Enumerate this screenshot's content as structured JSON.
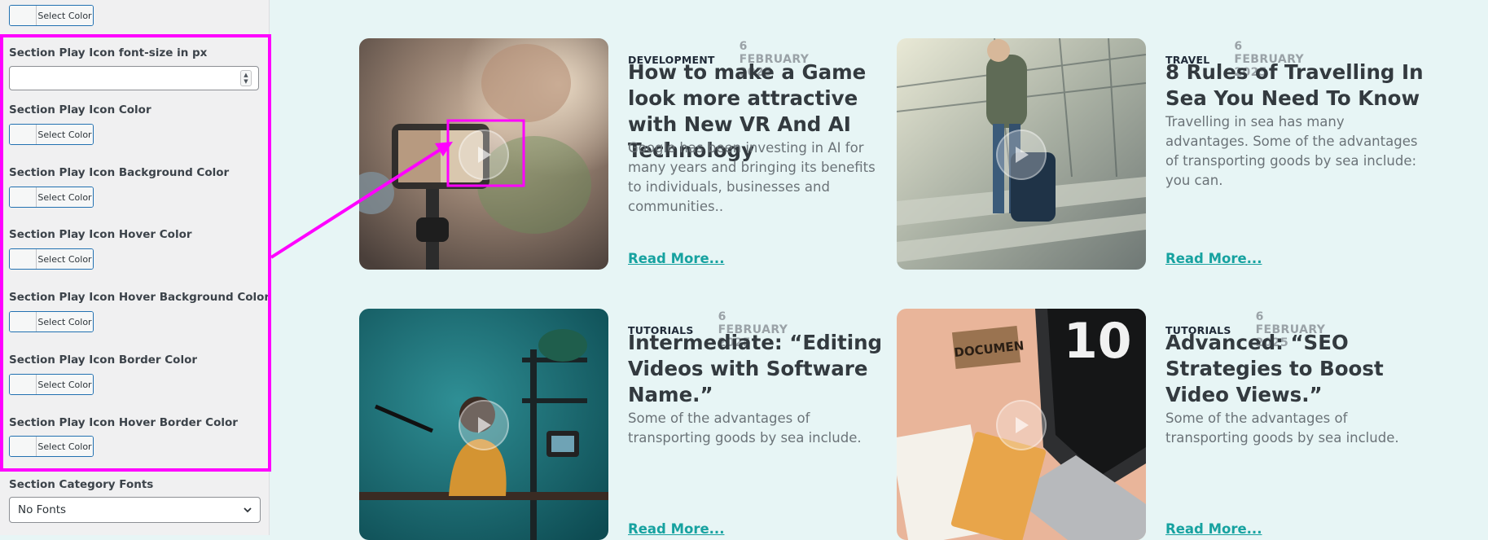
{
  "sidebar": {
    "top_color_button": "Select Color",
    "fontsize_field": {
      "label": "Section Play Icon font-size in px",
      "value": ""
    },
    "color_fields": [
      {
        "label": "Section Play Icon Color",
        "button": "Select Color"
      },
      {
        "label": "Section Play Icon Background Color",
        "button": "Select Color"
      },
      {
        "label": "Section Play Icon Hover Color",
        "button": "Select Color"
      },
      {
        "label": "Section Play Icon Hover Background Color",
        "button": "Select Color"
      },
      {
        "label": "Section Play Icon Border Color",
        "button": "Select Color"
      },
      {
        "label": "Section Play Icon Hover Border Color",
        "button": "Select Color"
      }
    ],
    "category_fonts": {
      "label": "Section Category Fonts",
      "value": "No Fonts"
    }
  },
  "annotation": {
    "color": "#ff00ff"
  },
  "posts": [
    {
      "category": "DEVELOPMENT",
      "date": "6 FEBRUARY 2025",
      "title": "How to make a Game look more attractive with New VR And AI Technology",
      "excerpt": "Google has been investing in AI for many years and bringing its benefits to individuals, businesses and communities..",
      "read_more": "Read More..."
    },
    {
      "category": "TRAVEL",
      "date": "6 FEBRUARY 2025",
      "title": "8 Rules of Travelling In Sea You Need To Know",
      "excerpt": "Travelling in sea has many advantages. Some of the advantages of transporting goods by sea include: you can.",
      "read_more": "Read More..."
    },
    {
      "category": "TUTORIALS",
      "date": "6 FEBRUARY 2025",
      "title": "Intermediate: “Editing Videos with Software Name.”",
      "excerpt": "Some of the advantages of transporting goods by sea include.",
      "read_more": "Read More..."
    },
    {
      "category": "TUTORIALS",
      "date": "6 FEBRUARY 2025",
      "title": "Advanced: “SEO Strategies to Boost Video Views.”",
      "excerpt": "Some of the advantages of transporting goods by sea include.",
      "read_more": "Read More...",
      "thumb_text": {
        "doc": "DOCUMEN",
        "number": "10"
      }
    }
  ],
  "colors": {
    "accent": "#17a2a0",
    "panel_border": "#2271b1",
    "highlight": "#ff00ff"
  }
}
